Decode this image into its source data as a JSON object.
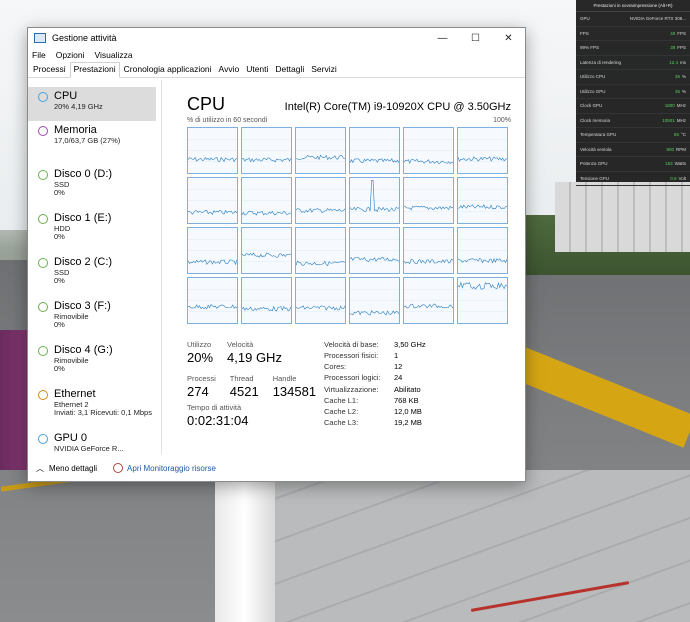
{
  "overlay": {
    "title": "Prestazioni in sovraimpressione (Alt+R)",
    "rows": [
      {
        "label": "GPU",
        "value": "NVIDIA GeForce RTX 308..."
      },
      {
        "label": "FPS",
        "value": "40",
        "unit": "FPS"
      },
      {
        "label": "99% FPS",
        "value": "38",
        "unit": "FPS"
      },
      {
        "label": "Latenza di rendering",
        "value": "12.4",
        "unit": "ms"
      },
      {
        "label": "Utilizzo CPU",
        "value": "36",
        "unit": "%"
      },
      {
        "label": "Utilizzo GPU",
        "value": "35",
        "unit": "%"
      },
      {
        "label": "Clock GPU",
        "value": "1800",
        "unit": "MHz"
      },
      {
        "label": "Clock memoria",
        "value": "10501",
        "unit": "MHz"
      },
      {
        "label": "Temperatura GPU",
        "value": "55",
        "unit": "°C"
      },
      {
        "label": "Velocità ventola",
        "value": "800",
        "unit": "RPM"
      },
      {
        "label": "Potenza GPU",
        "value": "153",
        "unit": "Watts"
      },
      {
        "label": "Tensione GPU",
        "value": "0.9",
        "unit": "Volt"
      }
    ]
  },
  "window": {
    "title": "Gestione attività",
    "controls": {
      "minimize": "—",
      "maximize": "☐",
      "close": "✕"
    }
  },
  "menu": [
    "File",
    "Opzioni",
    "Visualizza"
  ],
  "tabs": [
    "Processi",
    "Prestazioni",
    "Cronologia applicazioni",
    "Avvio",
    "Utenti",
    "Dettagli",
    "Servizi"
  ],
  "active_tab": "Prestazioni",
  "sidebar": [
    {
      "name": "CPU",
      "sub1": "20% 4,19 GHz",
      "sub2": "",
      "color": "#4a9fe0"
    },
    {
      "name": "Memoria",
      "sub1": "17,0/63,7 GB (27%)",
      "sub2": "",
      "color": "#a347b6"
    },
    {
      "name": "Disco 0 (D:)",
      "sub1": "SSD",
      "sub2": "0%",
      "color": "#6ab04c"
    },
    {
      "name": "Disco 1 (E:)",
      "sub1": "HDD",
      "sub2": "0%",
      "color": "#6ab04c"
    },
    {
      "name": "Disco 2 (C:)",
      "sub1": "SSD",
      "sub2": "0%",
      "color": "#6ab04c"
    },
    {
      "name": "Disco 3 (F:)",
      "sub1": "Rimovibile",
      "sub2": "0%",
      "color": "#6ab04c"
    },
    {
      "name": "Disco 4 (G:)",
      "sub1": "Rimovibile",
      "sub2": "0%",
      "color": "#6ab04c"
    },
    {
      "name": "Ethernet",
      "sub1": "Ethernet 2",
      "sub2": "Inviati: 3,1 Ricevuti: 0,1 Mbps",
      "color": "#d2891f"
    },
    {
      "name": "GPU 0",
      "sub1": "NVIDIA GeForce R...",
      "sub2": "",
      "color": "#4a9fe0"
    }
  ],
  "main": {
    "title": "CPU",
    "model": "Intel(R) Core(TM) i9-10920X CPU @ 3.50GHz",
    "graph_label_left": "% di utilizzo in 60 secondi",
    "graph_label_right": "100%"
  },
  "stats": {
    "utilizzo_label": "Utilizzo",
    "utilizzo": "20%",
    "velocita_label": "Velocità",
    "velocita": "4,19 GHz",
    "processi_label": "Processi",
    "processi": "274",
    "thread_label": "Thread",
    "thread": "4521",
    "handle_label": "Handle",
    "handle": "134581",
    "tempo_label": "Tempo di attività",
    "tempo": "0:02:31:04"
  },
  "info": [
    {
      "k": "Velocità di base:",
      "v": "3,50 GHz"
    },
    {
      "k": "Processori fisici:",
      "v": "1"
    },
    {
      "k": "Cores:",
      "v": "12"
    },
    {
      "k": "Processori logici:",
      "v": "24"
    },
    {
      "k": "Virtualizzazione:",
      "v": "Abilitato"
    },
    {
      "k": "Cache L1:",
      "v": "768 KB"
    },
    {
      "k": "Cache L2:",
      "v": "12,0 MB"
    },
    {
      "k": "Cache L3:",
      "v": "19,2 MB"
    }
  ],
  "footer": {
    "less_details": "Meno dettagli",
    "open_monitor": "Apri Monitoraggio risorse"
  },
  "colors": {
    "accent": "#4a9fe0",
    "graph_line": "#1f78c1",
    "graph_border": "#7db0de"
  }
}
